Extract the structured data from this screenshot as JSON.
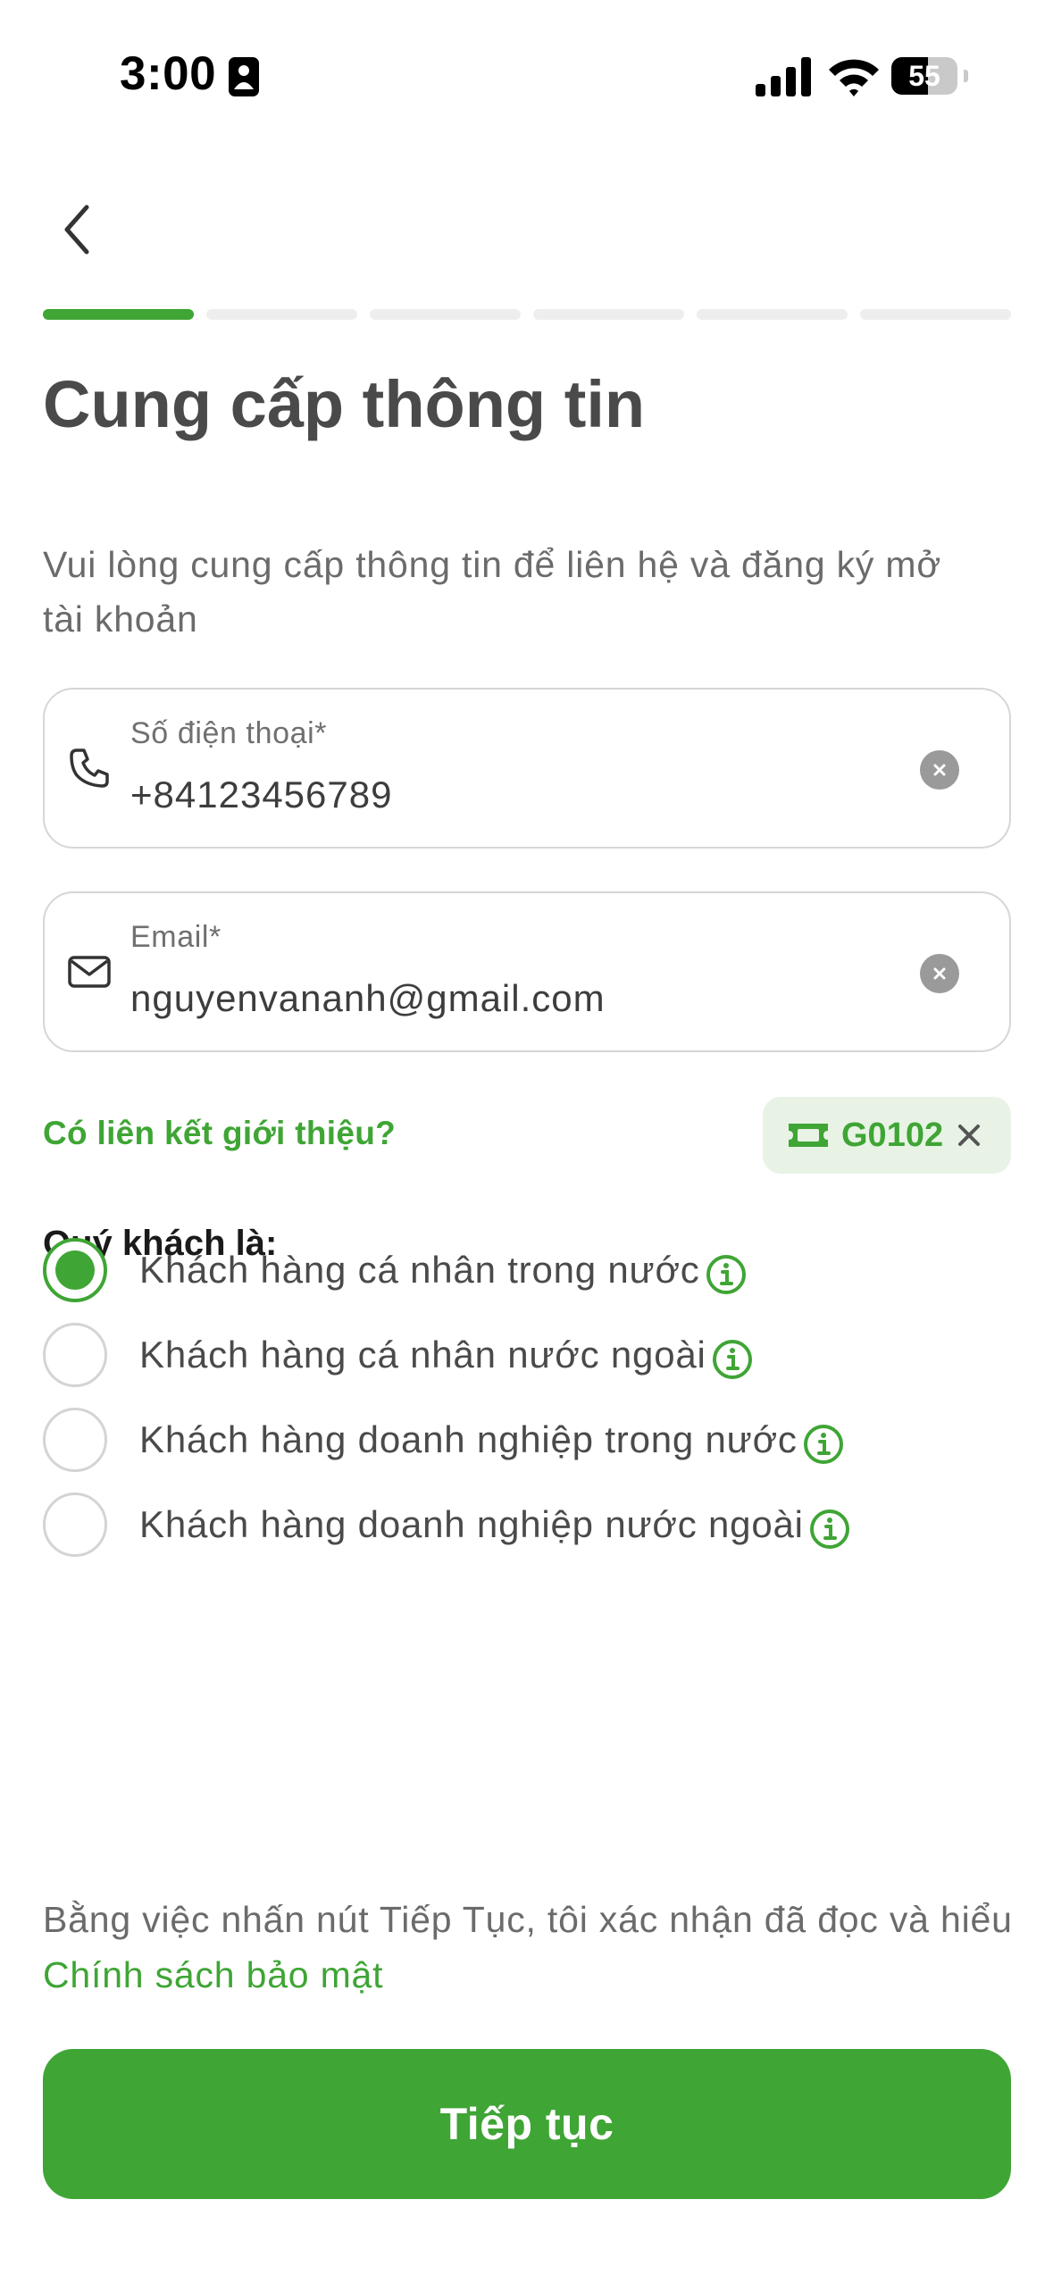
{
  "status_bar": {
    "time": "3:00",
    "battery": "55",
    "battery_level": 0.55
  },
  "progress": {
    "total_steps": 6,
    "current_step": 1
  },
  "page": {
    "title": "Cung cấp thông tin",
    "subtitle": "Vui lòng cung cấp thông tin để liên hệ và đăng ký mở tài khoản"
  },
  "form": {
    "phone": {
      "label": "Số điện thoại*",
      "value": "+84123456789",
      "icon": "phone-icon"
    },
    "email": {
      "label": "Email*",
      "value": "nguyenvananh@gmail.com",
      "icon": "mail-icon"
    }
  },
  "referral": {
    "link_label": "Có liên kết giới thiệu?",
    "code": "G0102",
    "icon": "ticket-icon"
  },
  "customer_type": {
    "question": "Quý khách là:",
    "options": [
      {
        "label": "Khách hàng cá nhân trong nước",
        "selected": true
      },
      {
        "label": "Khách hàng cá nhân nước ngoài",
        "selected": false
      },
      {
        "label": "Khách hàng doanh nghiệp trong nước",
        "selected": false
      },
      {
        "label": "Khách hàng doanh nghiệp nước ngoài",
        "selected": false
      }
    ]
  },
  "consent": {
    "text": "Bằng việc nhấn nút Tiếp Tục, tôi xác nhận đã đọc và hiểu ",
    "link": "Chính sách bảo mật"
  },
  "actions": {
    "continue_label": "Tiếp tục"
  },
  "colors": {
    "accent": "#3fa535",
    "accent_light": "#e8f3e5",
    "text": "#4a4a4a"
  }
}
